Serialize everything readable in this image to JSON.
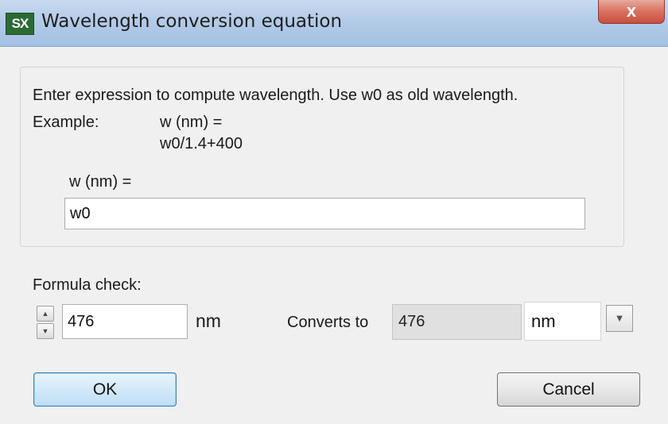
{
  "window": {
    "app_icon": "SX",
    "title": "Wavelength conversion equation",
    "close_label": "x"
  },
  "instructions": {
    "line1": "Enter expression to compute wavelength. Use w0 as old wavelength.",
    "example_label": "Example:",
    "example_lhs": "w (nm) =",
    "example_rhs": "w0/1.4+400"
  },
  "expression": {
    "label": "w (nm) =",
    "value": "w0"
  },
  "formula_check": {
    "label": "Formula check:",
    "input_value": "476",
    "input_unit": "nm",
    "converts_label": "Converts to",
    "result_value": "476",
    "result_unit": "nm",
    "spin_up_icon": "triangle-up",
    "spin_down_icon": "triangle-down",
    "dropdown_icon": "triangle-down"
  },
  "buttons": {
    "ok": "OK",
    "cancel": "Cancel"
  }
}
